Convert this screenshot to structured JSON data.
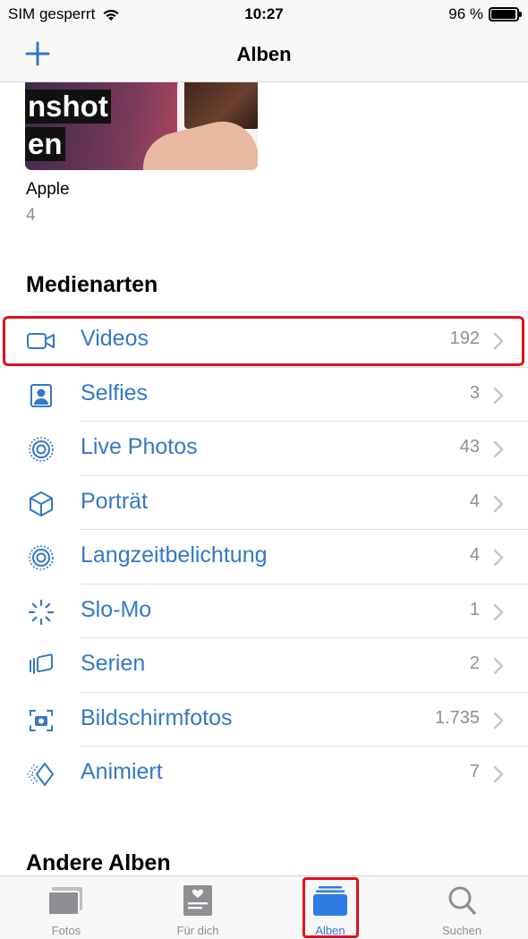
{
  "status_bar": {
    "carrier": "SIM gesperrt",
    "time": "10:27",
    "battery_percent": "96 %",
    "battery_level": 0.96
  },
  "nav": {
    "title": "Alben",
    "add_icon": "plus-icon"
  },
  "album_preview": {
    "thumb_text_line1": "nshot",
    "thumb_text_line2": "en",
    "name": "Apple",
    "count": "4"
  },
  "media_types": {
    "header": "Medienarten",
    "items": [
      {
        "label": "Videos",
        "count": "192",
        "icon": "video-camera-icon",
        "highlighted": true
      },
      {
        "label": "Selfies",
        "count": "3",
        "icon": "selfie-portrait-icon"
      },
      {
        "label": "Live Photos",
        "count": "43",
        "icon": "live-photo-icon"
      },
      {
        "label": "Porträt",
        "count": "4",
        "icon": "cube-icon"
      },
      {
        "label": "Langzeitbelichtung",
        "count": "4",
        "icon": "long-exposure-icon"
      },
      {
        "label": "Slo-Mo",
        "count": "1",
        "icon": "slomo-icon"
      },
      {
        "label": "Serien",
        "count": "2",
        "icon": "burst-icon"
      },
      {
        "label": "Bildschirmfotos",
        "count": "1.735",
        "icon": "screenshot-icon"
      },
      {
        "label": "Animiert",
        "count": "7",
        "icon": "animated-icon"
      }
    ]
  },
  "other_albums": {
    "header": "Andere Alben"
  },
  "tab_bar": {
    "tabs": [
      {
        "label": "Fotos",
        "icon": "photos-icon"
      },
      {
        "label": "Für dich",
        "icon": "for-you-icon"
      },
      {
        "label": "Alben",
        "icon": "albums-icon",
        "active": true
      },
      {
        "label": "Suchen",
        "icon": "search-icon"
      }
    ]
  },
  "colors": {
    "accent": "#3478c6",
    "highlight": "#e0101c",
    "secondary_text": "#8e8e93"
  }
}
